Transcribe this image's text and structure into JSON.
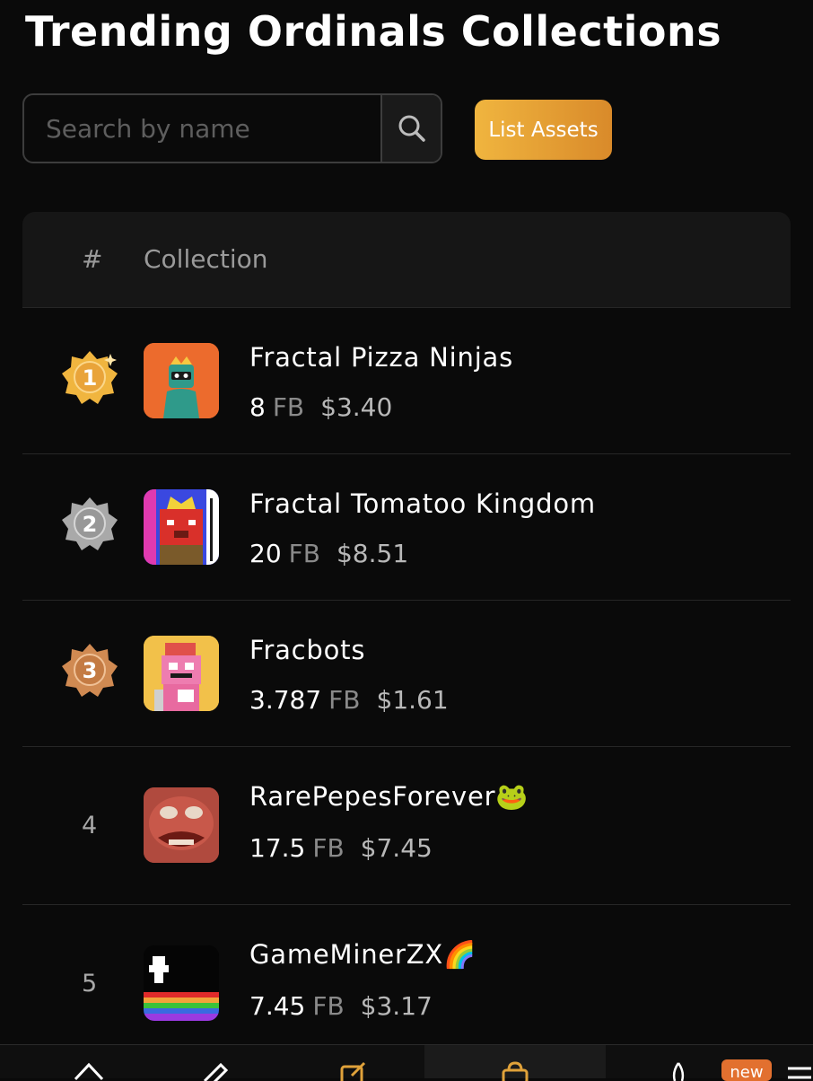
{
  "page": {
    "title": "Trending Ordinals Collections"
  },
  "search": {
    "placeholder": "Search by name",
    "value": "",
    "icon": "search-icon"
  },
  "actions": {
    "list_assets_label": "List Assets"
  },
  "table": {
    "columns": {
      "rank": "#",
      "collection": "Collection"
    },
    "rows": [
      {
        "rank": "1",
        "badge": "gold",
        "name": "Fractal Pizza Ninjas",
        "amount": "8",
        "unit": "FB",
        "usd": "$3.40"
      },
      {
        "rank": "2",
        "badge": "silver",
        "name": "Fractal Tomatoo Kingdom",
        "amount": "20",
        "unit": "FB",
        "usd": "$8.51"
      },
      {
        "rank": "3",
        "badge": "bronze",
        "name": "Fracbots",
        "amount": "3.787",
        "unit": "FB",
        "usd": "$1.61"
      },
      {
        "rank": "4",
        "badge": "",
        "name": "RarePepesForever🐸",
        "amount": "17.5",
        "unit": "FB",
        "usd": "$7.45"
      },
      {
        "rank": "5",
        "badge": "",
        "name": "GameMinerZX🌈",
        "amount": "7.45",
        "unit": "FB",
        "usd": "$3.17"
      }
    ]
  },
  "bottom_nav": {
    "items": [
      "home-icon",
      "pencil-icon",
      "edit-icon",
      "bag-icon",
      "flame-icon",
      "menu-icon"
    ],
    "new_badge": "new"
  },
  "colors": {
    "background": "#0a0a0a",
    "accent_gold": "#f0b53f",
    "accent_orange": "#d98a2a",
    "badge_silver": "#a9a9a9",
    "badge_bronze": "#d08a52",
    "new_badge": "#e2702f"
  }
}
